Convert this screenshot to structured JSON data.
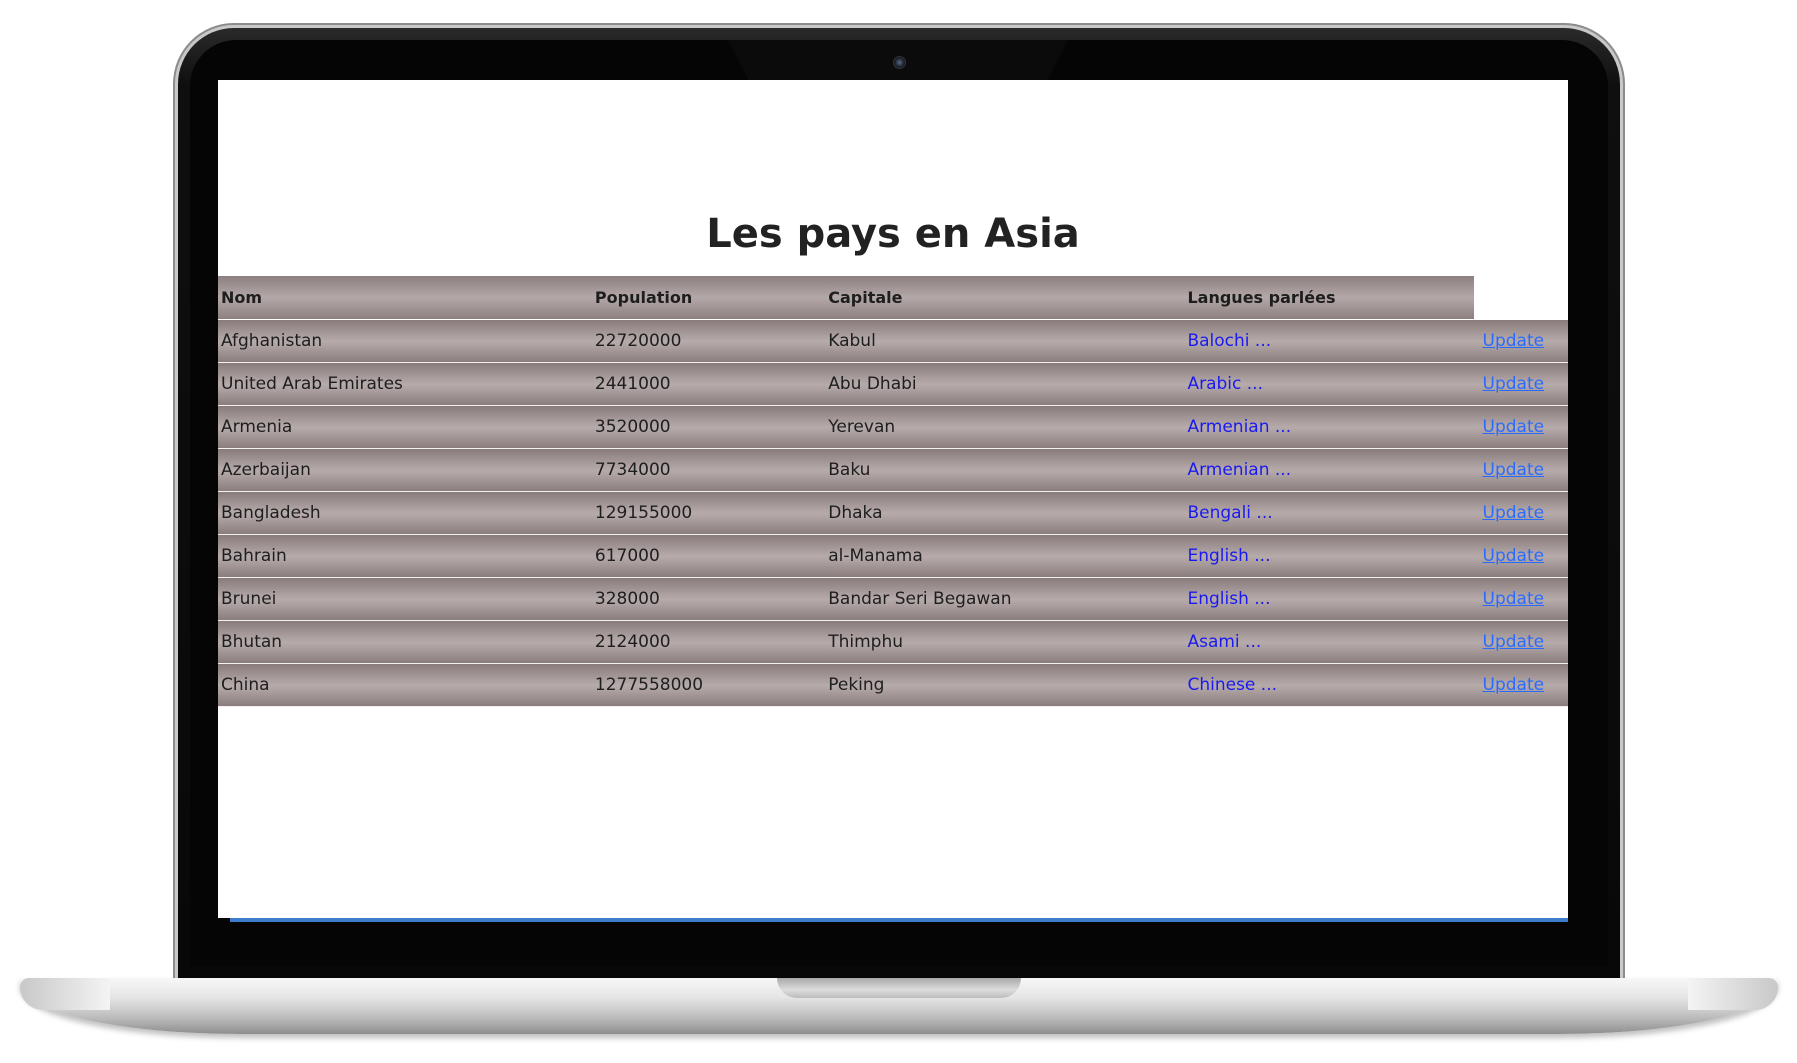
{
  "page": {
    "title": "Les pays en Asia"
  },
  "table": {
    "headers": {
      "nom": "Nom",
      "population": "Population",
      "capitale": "Capitale",
      "langues": "Langues parlées"
    },
    "update_label": "Update",
    "rows": [
      {
        "nom": "Afghanistan",
        "population": "22720000",
        "capitale": "Kabul",
        "langues": "Balochi ..."
      },
      {
        "nom": "United Arab Emirates",
        "population": "2441000",
        "capitale": "Abu Dhabi",
        "langues": "Arabic ..."
      },
      {
        "nom": "Armenia",
        "population": "3520000",
        "capitale": "Yerevan",
        "langues": "Armenian ..."
      },
      {
        "nom": "Azerbaijan",
        "population": "7734000",
        "capitale": "Baku",
        "langues": "Armenian ..."
      },
      {
        "nom": "Bangladesh",
        "population": "129155000",
        "capitale": "Dhaka",
        "langues": "Bengali ..."
      },
      {
        "nom": "Bahrain",
        "population": "617000",
        "capitale": "al-Manama",
        "langues": "English ..."
      },
      {
        "nom": "Brunei",
        "population": "328000",
        "capitale": "Bandar Seri Begawan",
        "langues": "English ..."
      },
      {
        "nom": "Bhutan",
        "population": "2124000",
        "capitale": "Thimphu",
        "langues": "Asami ..."
      },
      {
        "nom": "China",
        "population": "1277558000",
        "capitale": "Peking",
        "langues": "Chinese ..."
      }
    ]
  },
  "colors": {
    "row_gradient_dark": "#8a7c7c",
    "row_gradient_light": "#b6abab",
    "language_link": "#1a1af0",
    "update_link": "#2a6bff",
    "screen_underline": "#3d7cc9"
  }
}
